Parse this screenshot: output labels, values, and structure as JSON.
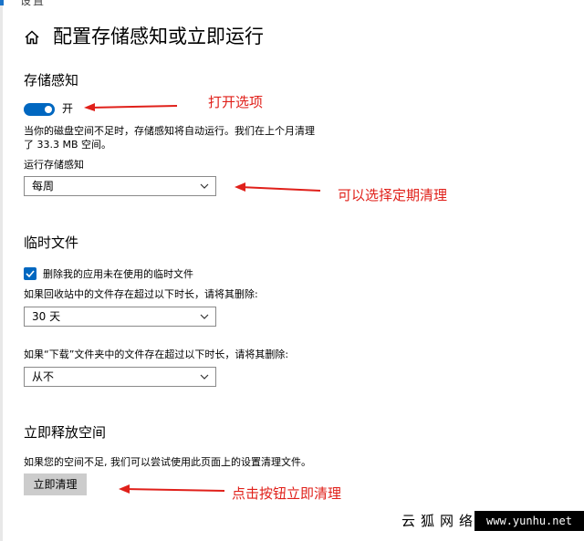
{
  "window": {
    "title_fragment": "设置"
  },
  "header": {
    "title": "配置存储感知或立即运行",
    "home_icon": "home-icon"
  },
  "storage_sense": {
    "heading": "存储感知",
    "toggle_state": "on",
    "toggle_label": "开",
    "description_line1": "当你的磁盘空间不足时，存储感知将自动运行。我们在上个月清理",
    "description_line2": "了 33.3 MB 空间。",
    "run_label": "运行存储感知",
    "run_value": "每周"
  },
  "temp_files": {
    "heading": "临时文件",
    "checkbox_checked": true,
    "checkbox_label": "删除我的应用未在使用的临时文件",
    "recycle_label": "如果回收站中的文件存在超过以下时长，请将其删除:",
    "recycle_value": "30 天",
    "downloads_label": "如果“下载”文件夹中的文件存在超过以下时长，请将其删除:",
    "downloads_value": "从不"
  },
  "free_now": {
    "heading": "立即释放空间",
    "description": "如果您的空间不足, 我们可以尝试使用此页面上的设置清理文件。",
    "button_label": "立即清理"
  },
  "annotations": {
    "toggle_note": "打开选项",
    "select_note": "可以选择定期清理",
    "button_note": "点击按钮立即清理",
    "color": "#e0201a"
  },
  "watermark": {
    "cn": "云狐网络",
    "url": "www.yunhu.net"
  },
  "colors": {
    "accent": "#0067c0",
    "button_bg": "#cccccc"
  }
}
